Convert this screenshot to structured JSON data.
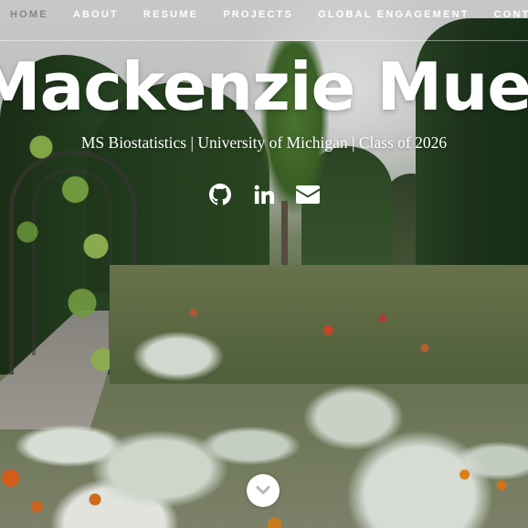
{
  "nav": {
    "items": [
      {
        "label": "HOME",
        "active": true
      },
      {
        "label": "ABOUT",
        "active": false
      },
      {
        "label": "RESUME",
        "active": false
      },
      {
        "label": "PROJECTS",
        "active": false
      },
      {
        "label": "GLOBAL ENGAGEMENT",
        "active": false
      },
      {
        "label": "CONTACT",
        "active": false
      }
    ],
    "active_color": "#8d8482",
    "text_color": "#ffffff"
  },
  "hero": {
    "name": "Mackenzie Mueller",
    "subtitle": "MS Biostatistics | University of Michigan | Class of 2026"
  },
  "social": [
    {
      "icon": "github-icon"
    },
    {
      "icon": "linkedin-icon"
    },
    {
      "icon": "envelope-icon"
    }
  ],
  "scroll": {
    "icon": "chevron-down-icon",
    "icon_color": "#bfb8b6"
  }
}
